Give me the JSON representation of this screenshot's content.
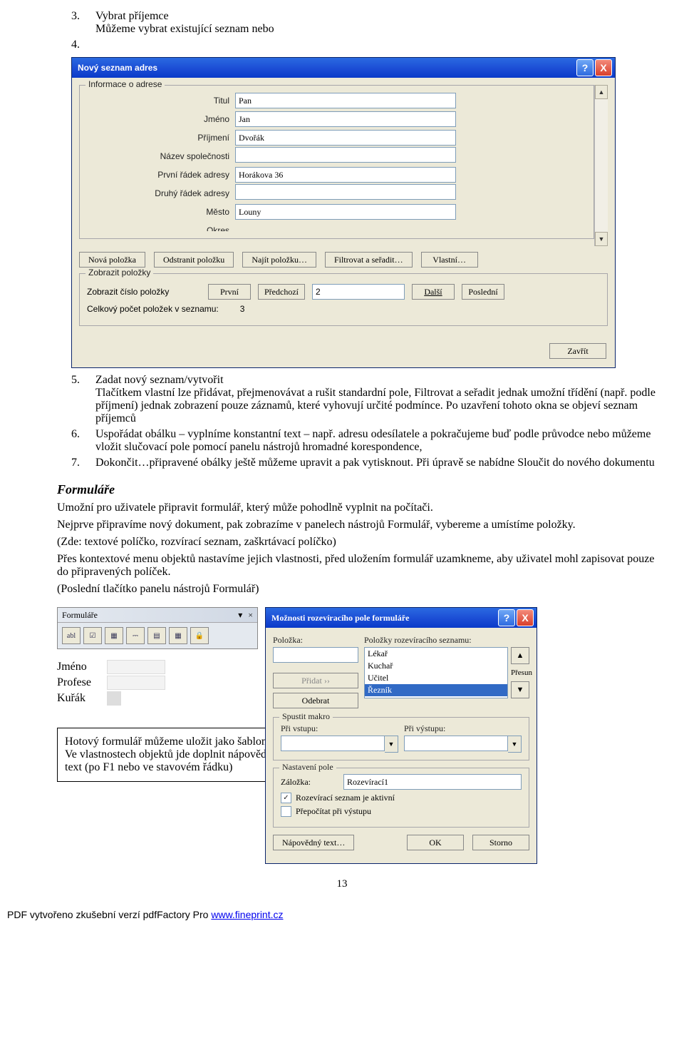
{
  "doc": {
    "item3_num": "3.",
    "item3_txt": "Vybrat příjemce",
    "item3_sub": "Můžeme vybrat existující seznam nebo",
    "item4_num": "4.",
    "item5_num": "5.",
    "item5_txt": "Zadat nový seznam/vytvořit",
    "item5_body": "Tlačítkem vlastní lze přidávat, přejmenovávat a rušit standardní pole, Filtrovat a seřadit jednak umožní třídění (např. podle příjmení) jednak zobrazení pouze záznamů, které vyhovují určité podmínce. Po uzavření tohoto okna se objeví seznam příjemců",
    "item6_num": "6.",
    "item6_txt": "Uspořádat obálku – vyplníme konstantní text – např. adresu odesílatele a pokračujeme buď podle průvodce nebo můžeme vložit slučovací pole pomocí panelu nástrojů hromadné korespondence,",
    "item7_num": "7.",
    "item7_txt": "Dokončit…připravené obálky ještě můžeme upravit a pak vytisknout. Při úpravě se nabídne Sloučit do nového dokumentu",
    "formulare_h": "Formuláře",
    "formulare_p1": "Umožní pro uživatele připravit formulář, který může pohodlně vyplnit na počítači.",
    "formulare_p2": "Nejprve připravíme nový dokument, pak zobrazíme v panelech nástrojů Formulář, vybereme a umístíme položky.",
    "formulare_p3": "(Zde: textové políčko, rozvírací seznam, zaškrtávací políčko)",
    "formulare_p4": "Přes kontextové menu objektů nastavíme jejich vlastnosti, před uložením formulář uzamkneme, aby uživatel mohl zapisovat pouze do připravených políček.",
    "formulare_p5": "(Poslední tlačítko panelu nástrojů Formulář)",
    "note": "Hotový formulář můžeme uložit jako šablonu.\nVe vlastnostech objektů jde doplnit nápovědný text (po F1 nebo ve stavovém řádku)",
    "pagenum": "13",
    "footer_pre": "PDF vytvořeno zkušební verzí pdfFactory Pro ",
    "footer_link": "www.fineprint.cz"
  },
  "dlg1": {
    "title": "Nový seznam adres",
    "help": "?",
    "close": "X",
    "fs1": "Informace o adrese",
    "l_titul": "Titul",
    "v_titul": "Pan",
    "l_jmeno": "Jméno",
    "v_jmeno": "Jan",
    "l_prijmeni": "Příjmení",
    "v_prijmeni": "Dvořák",
    "l_spol": "Název společnosti",
    "v_spol": "",
    "l_adr1": "První řádek adresy",
    "v_adr1": "Horákova 36",
    "l_adr2": "Druhý řádek adresy",
    "v_adr2": "",
    "l_mesto": "Město",
    "v_mesto": "Louny",
    "l_okres": "Okres",
    "btn_nova": "Nová položka",
    "btn_odstranit": "Odstranit položku",
    "btn_najit": "Najít položku…",
    "btn_filtrovat": "Filtrovat a seřadit…",
    "btn_vlastni": "Vlastní…",
    "fs2": "Zobrazit položky",
    "lbl_zobrazit": "Zobrazit číslo položky",
    "btn_prvni": "První",
    "btn_predchozi": "Předchozí",
    "val_cislo": "2",
    "btn_dalsi": "Další",
    "btn_posledni": "Poslední",
    "lbl_celkem": "Celkový počet položek v seznamu:",
    "val_celkem": "3",
    "btn_zavrit": "Zavřít"
  },
  "toolbar": {
    "title": "Formuláře",
    "drop": "▾",
    "close": "×",
    "i1": "abl",
    "i2": "☑",
    "i3": "▦",
    "i4": "⎓",
    "i5": "▤",
    "i6": "▦",
    "i7": "🔒"
  },
  "form": {
    "jmeno": "Jméno",
    "profese": "Profese",
    "kurak": "Kuřák"
  },
  "dlg2": {
    "title": "Možnosti rozevíracího pole formuláře",
    "help": "?",
    "close": "X",
    "lbl_polozka": "Položka:",
    "lbl_seznam": "Položky rozevíracího seznamu:",
    "opt1": "Lékař",
    "opt2": "Kuchař",
    "opt3": "Učitel",
    "opt4": "Řezník",
    "btn_pridat": "Přidat ››",
    "btn_odebrat": "Odebrat",
    "lbl_presun": "Přesun",
    "fs_makro": "Spustit makro",
    "lbl_privstupu": "Při vstupu:",
    "lbl_privystupu": "Při výstupu:",
    "fs_nastaveni": "Nastavení pole",
    "lbl_zalozka": "Záložka:",
    "val_zalozka": "Rozevírací1",
    "chk1": "Rozevírací seznam je aktivní",
    "chk2": "Přepočítat při výstupu",
    "btn_napoveda": "Nápovědný text…",
    "btn_ok": "OK",
    "btn_storno": "Storno"
  }
}
